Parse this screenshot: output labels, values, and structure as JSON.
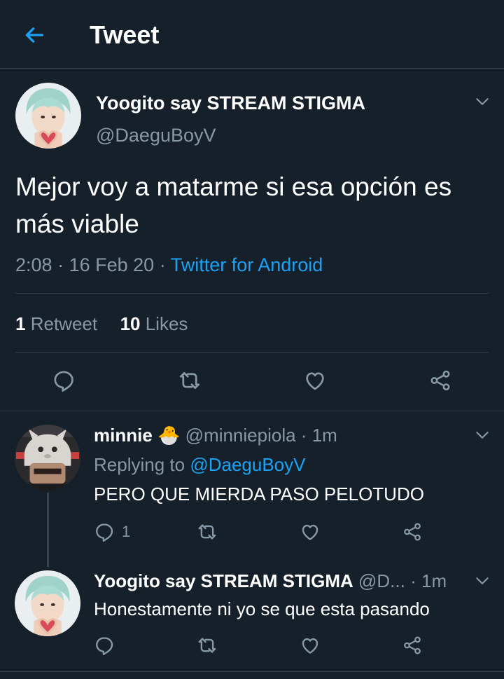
{
  "header": {
    "title": "Tweet",
    "back_icon": "arrow-left-icon"
  },
  "colors": {
    "background": "#15202b",
    "accent": "#1da1f2",
    "muted": "#8899a6",
    "divider": "#38444d"
  },
  "main_tweet": {
    "display_name": "Yoogito say STREAM STIGMA",
    "handle": "@DaeguBoyV",
    "text": "Mejor voy a matarme si esa opción es más viable",
    "time": "2:08",
    "date": "16 Feb 20",
    "separator": "·",
    "source": "Twitter for Android",
    "retweet_count": "1",
    "retweet_label": "Retweet",
    "like_count": "10",
    "like_label": "Likes"
  },
  "replies": [
    {
      "display_name": "minnie",
      "emoji": "🐣",
      "handle": "@minniepiola",
      "time": "1m",
      "separator": "·",
      "replying_prefix": "Replying to",
      "replying_to": "@DaeguBoyV",
      "text": "PERO QUE MIERDA PASO PELOTUDO",
      "reply_count": "1"
    },
    {
      "display_name": "Yoogito say STREAM STIGMA",
      "handle": "@D...",
      "time": "1m",
      "separator": "·",
      "text": "Honestamente ni yo se que esta pasando"
    }
  ]
}
